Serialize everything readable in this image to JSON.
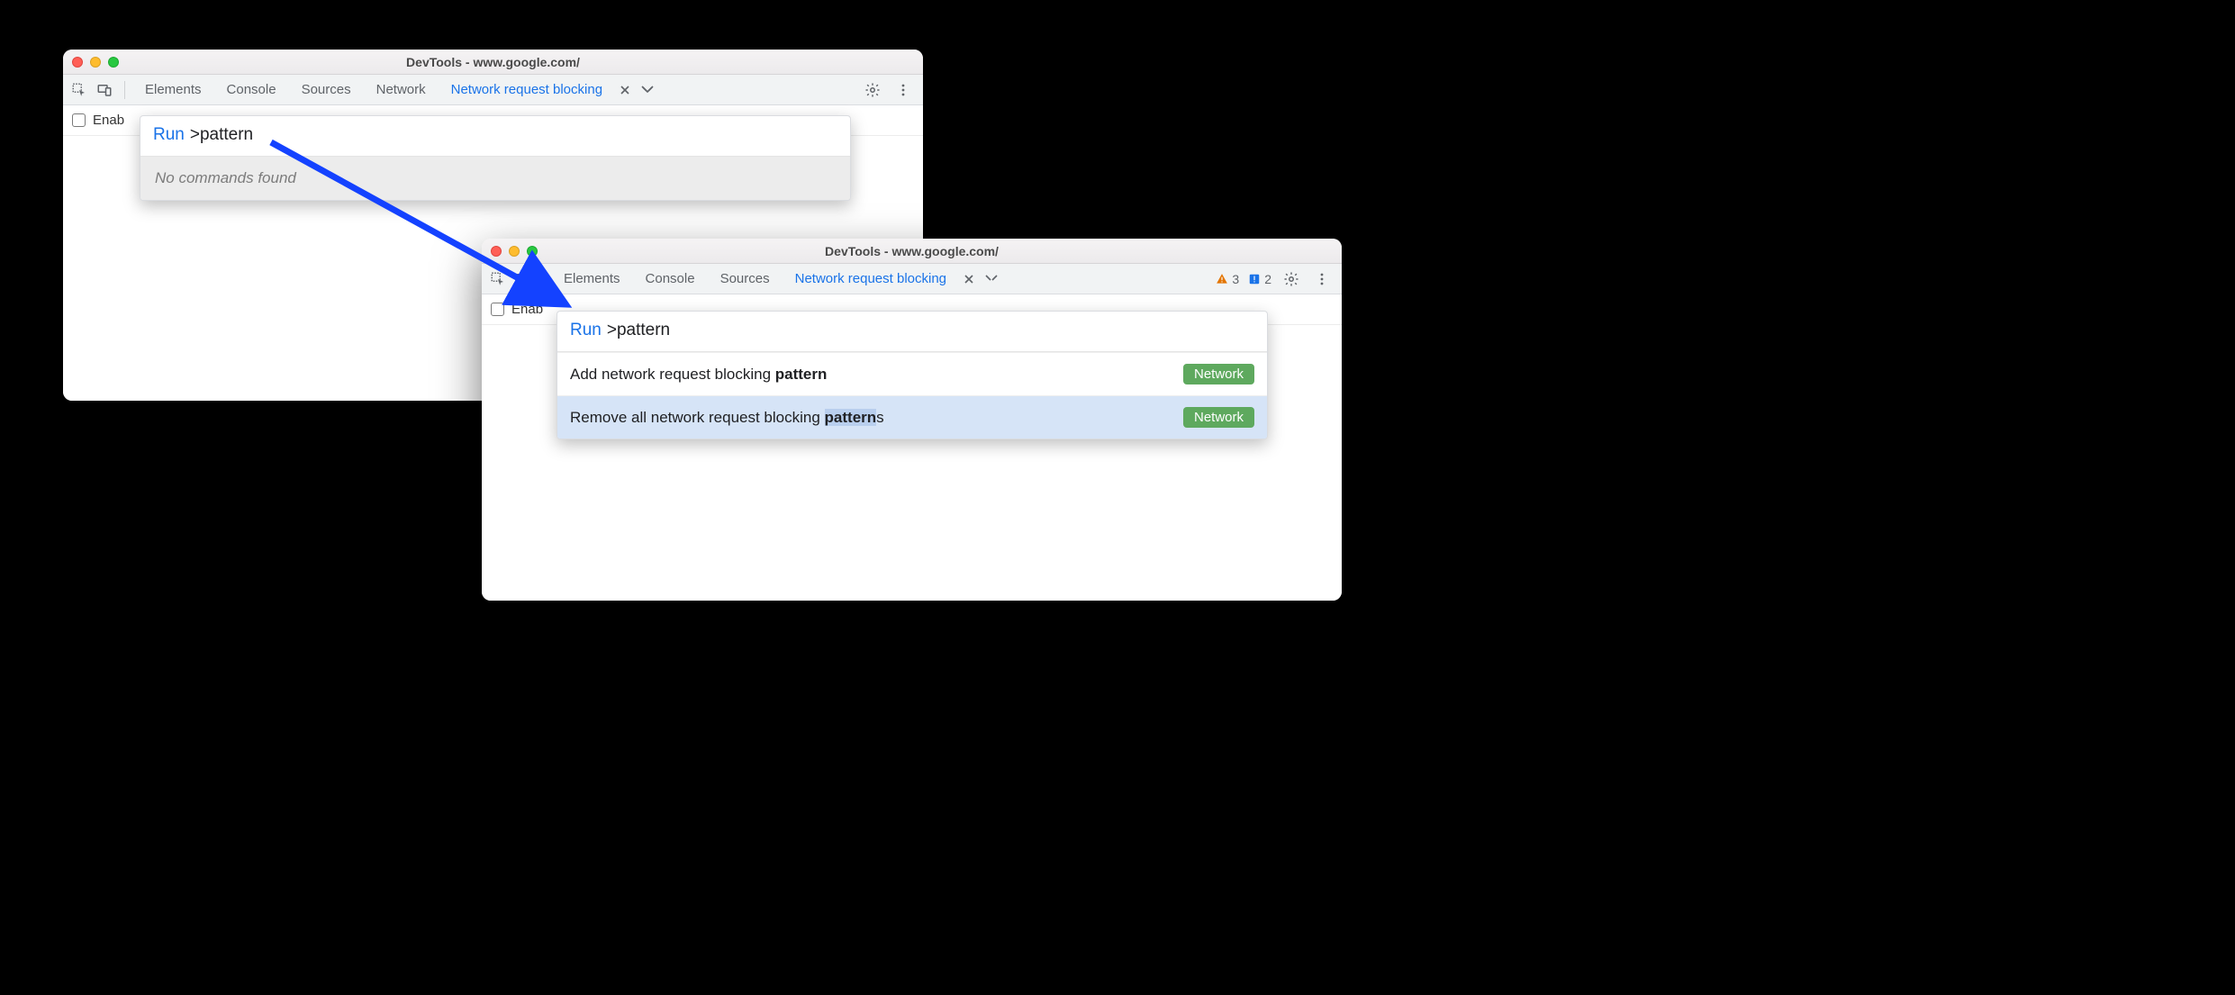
{
  "window_title": "DevTools - www.google.com/",
  "tabs": {
    "elements": "Elements",
    "console": "Console",
    "sources": "Sources",
    "network": "Network",
    "nrb": "Network request blocking"
  },
  "enable_label_truncated": "Enab",
  "command_menu": {
    "run_label": "Run",
    "query": ">pattern",
    "empty_message": "No commands found",
    "results": [
      {
        "prefix": "Add network request blocking ",
        "match": "pattern",
        "suffix": "",
        "category": "Network"
      },
      {
        "prefix": "Remove all network request blocking ",
        "match": "pattern",
        "suffix": "s",
        "category": "Network"
      }
    ]
  },
  "issue_counts": {
    "warnings": "3",
    "issues": "2"
  }
}
